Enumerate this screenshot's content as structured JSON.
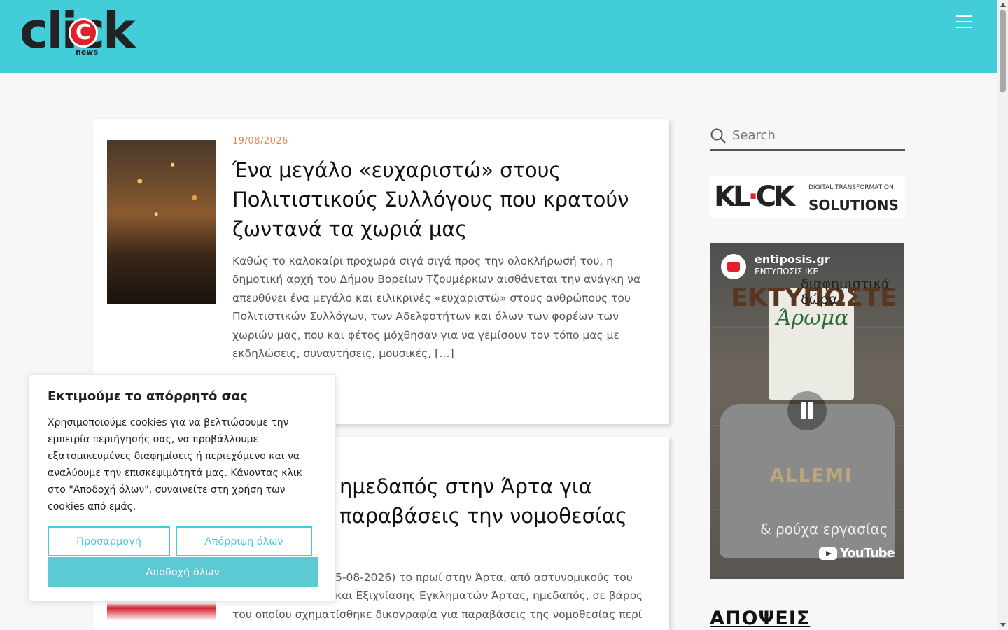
{
  "header": {
    "logo_text": "click",
    "logo_letter": "C",
    "logo_sub": "news",
    "menu_icon": "hamburger-icon",
    "bg_color": "#43cdd8"
  },
  "posts": [
    {
      "date": "19/08/2026",
      "title": "Ένα μεγάλο «ευχαριστώ» στους Πολιτιστικούς Συλλόγους που κρατούν ζωντανά τα χωριά μας",
      "excerpt": "Καθώς το καλοκαίρι προχωρά σιγά σιγά προς την ολοκλήρωσή του, η δημοτική αρχή του Δήμου Βορείων Τζουμέρκων αισθάνεται την ανάγκη να απευθύνει ένα μεγάλο και ειλικρινές «ευχαριστώ» στους ανθρώπους του Πολιτιστικών Συλλόγων, των Αδελφοτήτων και όλων των φορέων των χωριών μας, που και φέτος μόχθησαν για να γεμίσουν τον τόπο μας με εκδηλώσεις, συναντήσεις, μουσικές, […]"
    },
    {
      "title": "ημεδαπός στην Άρτα για παραβάσεις την νομοθεσίας",
      "excerpt_lines": [
        "5-08-2026) το πρωί στην Άρτα, από αστυνομικούς του",
        "και Εξιχνίασης Εγκληματών Άρτας, ημεδαπός, σε βάρος",
        "του οποίου σχηματίσθηκε δικογραφία για παραβάσεις της νομοθεσίας περί"
      ]
    }
  ],
  "sidebar": {
    "search_placeholder": "Search",
    "banner_mark": "KL",
    "banner_mark_tail": "CK",
    "banner_small": "DIGITAL TRANSFORMATION",
    "banner_big": "SOLUTIONS",
    "video": {
      "channel": "entiposis.gr",
      "subtitle": "ΕΝΤΥΠΩΣΙΣ ΙΚΕ",
      "vertical_text": "ΕΚΤΥΠΩΣΤΕ",
      "top_caption": "διαφημιστικά δώρα",
      "bag_text": "Άρωμα",
      "shirt_text": "ALLEMI",
      "bottom_caption": "& ρούχα εργασίας",
      "youtube_label": "YouTube"
    },
    "opinions_heading": "ΑΠΟΨΕΙΣ"
  },
  "cookie": {
    "title": "Εκτιμούμε το απόρρητό σας",
    "text": "Χρησιμοποιούμε cookies για να βελτιώσουμε την εμπειρία περιήγησής σας, να προβάλλουμε εξατομικευμένες διαφημίσεις ή περιεχόμενο και να αναλύουμε την επισκεψιμότητά μας. Κάνοντας κλικ στο \"Αποδοχή όλων\", συναινείτε στη χρήση των cookies από εμάς.",
    "customize": "Προσαρμογή",
    "reject": "Απόρριψη όλων",
    "accept": "Αποδοχή όλων",
    "accent_color": "#43cdd8"
  }
}
